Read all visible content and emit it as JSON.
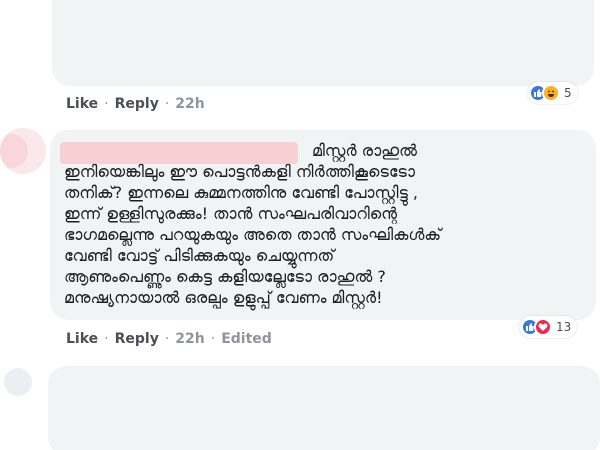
{
  "previous_comment": {
    "actions": {
      "like": "Like",
      "reply": "Reply",
      "time": "22h"
    },
    "reactions": {
      "types": [
        "like-icon",
        "haha-icon"
      ],
      "count": "5"
    }
  },
  "comment": {
    "author": "",
    "text": "മിസ്റ്റർ രാഹുൽ\nഇനിയെങ്കിലും ഈ പൊട്ടൻകളി നിർത്തികൂടെടോ\nതനിക്? ഇന്നലെ കുമ്മനത്തിനു വേണ്ടി പോസ്റ്റിട്ടു ,\nഇന്ന് ഉള്ളിസുരക്കും! താൻ സംഘപരിവാറിന്റെ\nഭാഗമല്ലെന്നു പറയുകയും അതെ താൻ സംഘികൾക്\nവേണ്ടി വോട്ട് പിടിക്കുകയും ചെയ്യുന്നത്\nആണുംപെണ്ണും കെട്ട കളിയല്ലേടോ രാഹുൽ ?\nമനുഷ്യനായാൽ ഒരല്പം ഉളുപ്പ് വേണം മിസ്റ്റർ!",
    "actions": {
      "like": "Like",
      "reply": "Reply",
      "time": "22h",
      "edited": "Edited"
    },
    "reactions": {
      "types": [
        "like-icon",
        "love-icon"
      ],
      "count": "13"
    }
  },
  "colors": {
    "bubble": "#f2f3f5",
    "action_link": "#4b4f56",
    "meta": "#90949c",
    "like": "#3578e5",
    "love": "#f0284a",
    "haha": "#f7b125"
  }
}
